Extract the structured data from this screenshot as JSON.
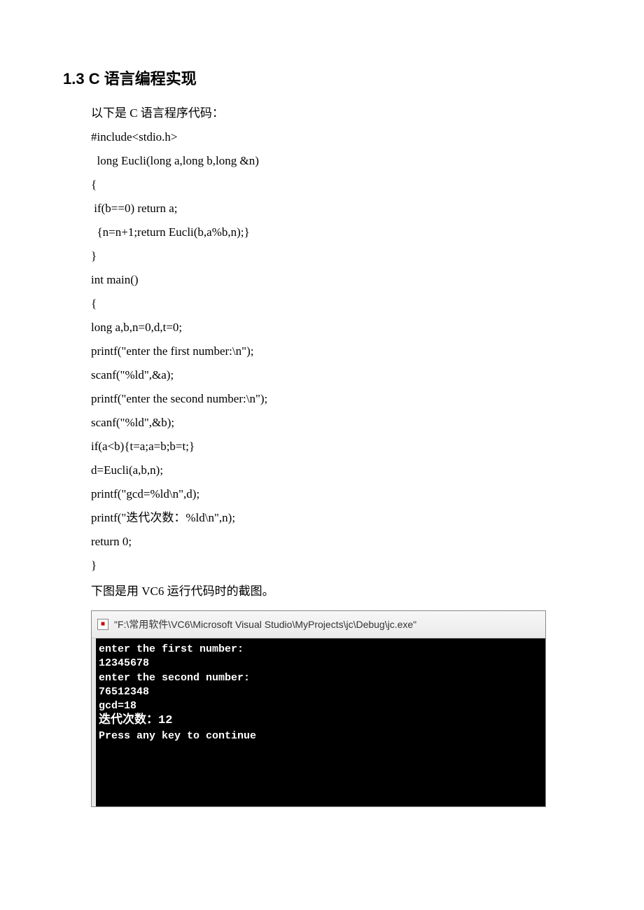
{
  "heading": "1.3 C 语言编程实现",
  "intro": "以下是 C 语言程序代码：",
  "code": [
    "#include<stdio.h>",
    "  long Eucli(long a,long b,long &n)",
    "{",
    " if(b==0) return a;",
    "  {n=n+1;return Eucli(b,a%b,n);}",
    "}",
    "int main()",
    "{",
    "long a,b,n=0,d,t=0;",
    "printf(\"enter the first number:\\n\");",
    "scanf(\"%ld\",&a);",
    "printf(\"enter the second number:\\n\");",
    "scanf(\"%ld\",&b);",
    "if(a<b){t=a;a=b;b=t;}",
    "d=Eucli(a,b,n);",
    "printf(\"gcd=%ld\\n\",d);",
    "printf(\"迭代次数：%ld\\n\",n);",
    "return 0;",
    "}"
  ],
  "caption": "下图是用 VC6 运行代码时的截图。",
  "console": {
    "title": "\"F:\\常用软件\\VC6\\Microsoft Visual Studio\\MyProjects\\jc\\Debug\\jc.exe\"",
    "lines": [
      "enter the first number:",
      "12345678",
      "enter the second number:",
      "76512348",
      "gcd=18",
      "迭代次数：12",
      "Press any key to continue"
    ]
  }
}
